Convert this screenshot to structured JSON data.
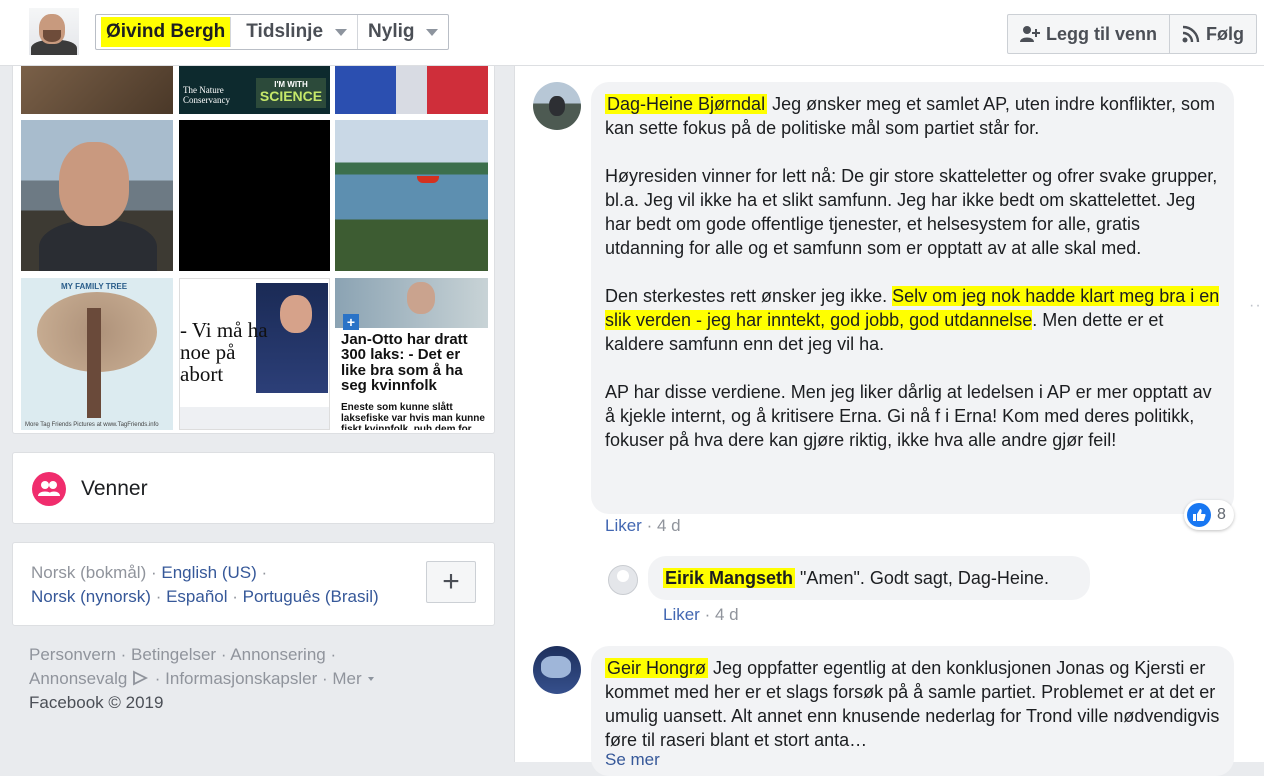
{
  "header": {
    "profile_name": "Øivind Bergh",
    "tabs": [
      {
        "label": "Tidslinje"
      },
      {
        "label": "Nylig"
      }
    ],
    "actions": {
      "add_friend": "Legg til venn",
      "follow": "Følg"
    }
  },
  "photos": {
    "tnc_logo": "The Nature Conservancy",
    "science_badge_top": "I'M WITH",
    "science_badge": "SCIENCE",
    "family_tree_title": "MY FAMILY TREE",
    "family_tree_footer": "More Tag Friends Pictures at www.TagFriends.info",
    "news_headline": "- Vi må ha noe på abort",
    "article_headline": "Jan-Otto har dratt 300 laks: - Det er like bra som å ha seg kvinnfolk",
    "article_sub": "Eneste som kunne slått laksefiske var hvis man kunne fiskt kvinnfolk, puh dem for"
  },
  "friends": {
    "label": "Venner"
  },
  "languages": {
    "current": "Norsk (bokmål)",
    "options": [
      "English (US)",
      "Norsk (nynorsk)",
      "Español",
      "Português (Brasil)"
    ],
    "add_label": "+"
  },
  "footer": {
    "links": [
      "Personvern",
      "Betingelser",
      "Annonsering",
      "Annonsevalg",
      "Informasjonskapsler",
      "Mer"
    ],
    "copyright": "Facebook © 2019"
  },
  "comments": [
    {
      "author": "Dag-Heine Bjørndal",
      "para1": "Jeg ønsker meg et samlet AP, uten indre konflikter, som kan sette fokus på de politiske mål som partiet står for.",
      "para2": "Høyresiden vinner for lett nå: De gir store skatteletter og ofrer svake grupper, bl.a. Jeg vil ikke ha et slikt samfunn. Jeg har ikke bedt om skattelettet. Jeg har bedt om gode offentlige tjenester, et helsesystem for alle, gratis utdanning for alle og et samfunn som er opptatt av at alle skal med.",
      "para3_pre": "Den sterkestes rett ønsker jeg ikke.",
      "para3_highlight": "Selv om jeg nok hadde klart meg bra i en slik verden - jeg har inntekt, god jobb, god utdannelse",
      "para3_post": ". Men dette er et kaldere samfunn enn det jeg vil ha.",
      "para4": "AP har disse verdiene. Men jeg liker dårlig at ledelsen i AP er mer opptatt av å kjekle internt, og å kritisere Erna. Gi nå f i Erna! Kom med deres politikk, fokuser på hva dere kan gjøre riktig, ikke hva alle andre gjør feil!",
      "like_label": "Liker",
      "time": "4 d",
      "reaction_count": "8"
    },
    {
      "author": "Eirik Mangseth",
      "text": "\"Amen\". Godt sagt, Dag-Heine.",
      "like_label": "Liker",
      "time": "4 d"
    },
    {
      "author": "Geir Hongrø",
      "text": "Jeg oppfatter egentlig at den konklusjonen Jonas og Kjersti er kommet med her er et slags forsøk på å samle partiet. Problemet er at det er umulig uansett. Alt annet enn knusende nederlag for Trond ville nødvendigvis føre til raseri blant et stort anta…",
      "see_more": "Se mer"
    }
  ],
  "colors": {
    "highlight": "#ffff00",
    "link": "#365899",
    "like_blue": "#1877f2",
    "friends_pink": "#f02d6d"
  }
}
